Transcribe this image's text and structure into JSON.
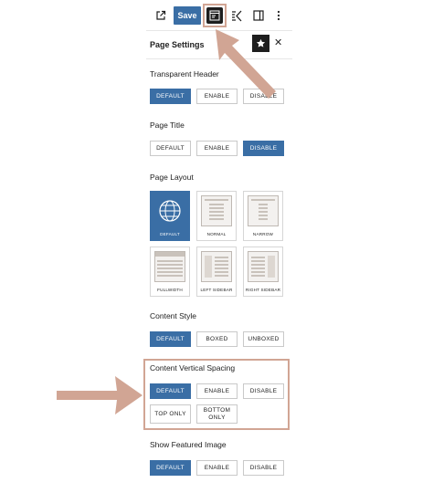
{
  "toolbar": {
    "save_label": "Save",
    "icons": [
      "external-link-icon",
      "page-settings-icon",
      "spectra-icon",
      "sidebar-toggle-icon",
      "more-options-icon"
    ]
  },
  "panel": {
    "title": "Page Settings"
  },
  "transparent_header": {
    "label": "Transparent Header",
    "options": [
      "DEFAULT",
      "ENABLE",
      "DISABLE"
    ],
    "selected": "DEFAULT"
  },
  "page_title": {
    "label": "Page Title",
    "options": [
      "DEFAULT",
      "ENABLE",
      "DISABLE"
    ],
    "selected": "DISABLE"
  },
  "page_layout": {
    "label": "Page Layout",
    "options": [
      "DEFAULT",
      "NORMAL",
      "NARROW",
      "FULLWIDTH",
      "LEFT SIDEBAR",
      "RIGHT SIDEBAR"
    ],
    "selected": "DEFAULT"
  },
  "content_style": {
    "label": "Content Style",
    "options": [
      "DEFAULT",
      "BOXED",
      "UNBOXED"
    ],
    "selected": "DEFAULT"
  },
  "content_vertical_spacing": {
    "label": "Content Vertical Spacing",
    "options": [
      "DEFAULT",
      "ENABLE",
      "DISABLE",
      "TOP ONLY",
      "BOTTOM ONLY"
    ],
    "selected": "DEFAULT"
  },
  "show_featured_image": {
    "label": "Show Featured Image",
    "options": [
      "DEFAULT",
      "ENABLE",
      "DISABLE"
    ],
    "selected": "DEFAULT"
  },
  "colors": {
    "accent": "#3a6ea5",
    "annotation": "#d1a594"
  }
}
